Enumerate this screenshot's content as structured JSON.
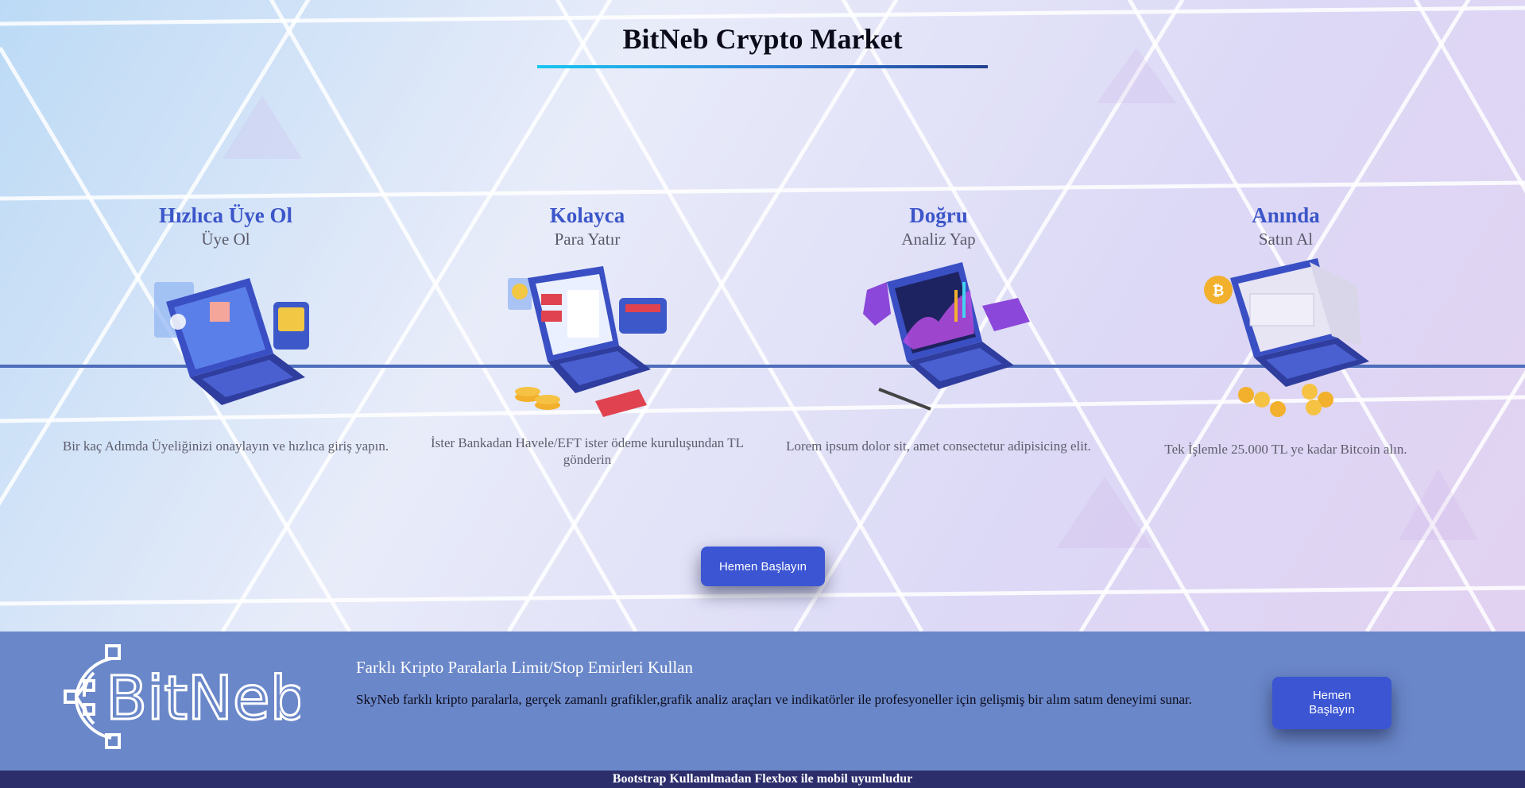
{
  "header": {
    "title": "BitNeb Crypto Market"
  },
  "steps": [
    {
      "heading": "Hızlıca Üye Ol",
      "subheading": "Üye Ol",
      "illustration": "laptop-login-illustration",
      "description": "Bir kaç Adımda Üyeliğinizi onaylayın ve hızlıca giriş yapın."
    },
    {
      "heading": "Kolayca",
      "subheading": "Para Yatır",
      "illustration": "laptop-wallet-illustration",
      "description": "İster Bankadan Havele/EFT ister ödeme kuruluşundan TL gönderin"
    },
    {
      "heading": "Doğru",
      "subheading": "Analiz Yap",
      "illustration": "laptop-analytics-illustration",
      "description": "Lorem ipsum dolor sit, amet consectetur adipisicing elit."
    },
    {
      "heading": "Anında",
      "subheading": "Satın Al",
      "illustration": "laptop-safe-bitcoin-illustration",
      "description": "Tek İşlemle 25.000 TL ye kadar Bitcoin alın."
    }
  ],
  "cta": {
    "label": "Hemen Başlayın"
  },
  "promo": {
    "logo_text": "BitNeb",
    "title": "Farklı Kripto Paralarla Limit/Stop Emirleri Kullan",
    "text": "SkyNeb farklı kripto paralarla, gerçek zamanlı grafikler,grafik analiz araçları ve indikatörler ile profesyoneller için gelişmiş bir alım satım deneyimi sunar.",
    "button_label": "Hemen Başlayın"
  },
  "footer": {
    "text": "Bootstrap Kullanılmadan Flexbox ile mobil uyumludur"
  },
  "colors": {
    "accent": "#3b55d3",
    "step_heading": "#3c56c9",
    "band": "#6a87c9",
    "footer": "#2c2d6b"
  }
}
